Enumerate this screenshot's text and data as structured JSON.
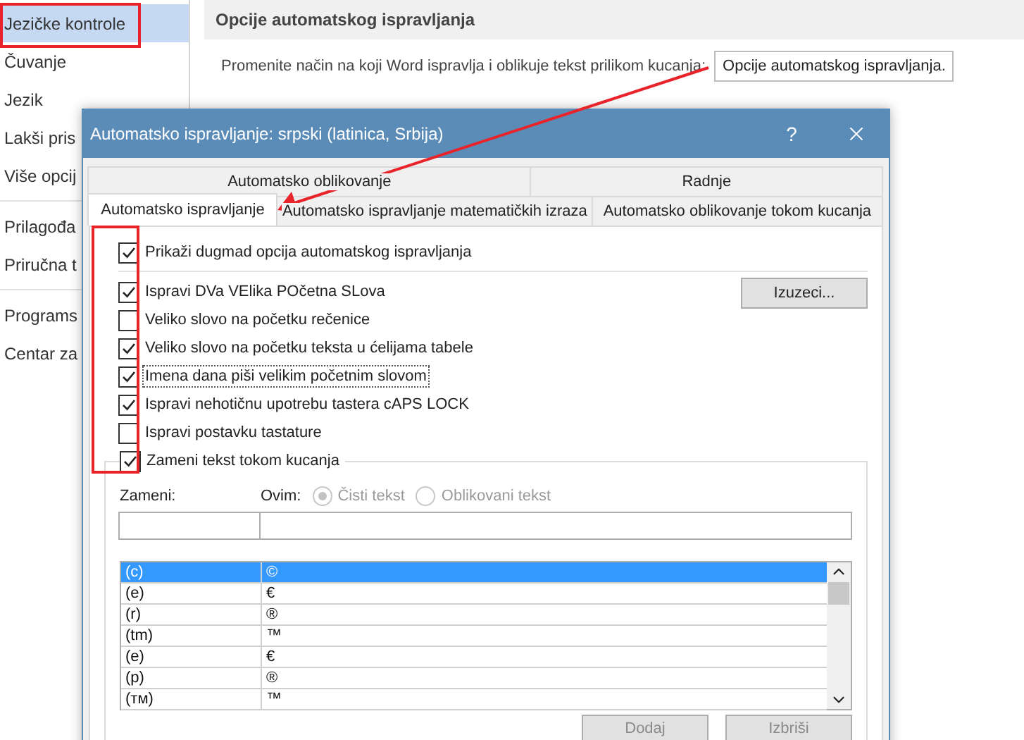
{
  "sidebar": {
    "groups": [
      {
        "items": [
          {
            "label": "Jezičke kontrole",
            "selected": true
          },
          {
            "label": "Čuvanje",
            "selected": false
          },
          {
            "label": "Jezik",
            "selected": false
          },
          {
            "label": "Lakši pris",
            "selected": false
          },
          {
            "label": "Više opcij",
            "selected": false
          }
        ]
      },
      {
        "items": [
          {
            "label": "Prilagođa",
            "selected": false
          },
          {
            "label": "Priručna t",
            "selected": false
          }
        ]
      },
      {
        "items": [
          {
            "label": "Programs",
            "selected": false
          },
          {
            "label": "Centar za",
            "selected": false
          }
        ]
      }
    ]
  },
  "main": {
    "section_title": "Opcije automatskog ispravljanja",
    "description": "Promenite način na koji Word ispravlja i oblikuje tekst prilikom kucanja:",
    "button": "Opcije automatskog ispravljanja."
  },
  "dialog": {
    "title": "Automatsko ispravljanje: srpski (latinica, Srbija)",
    "help": "?",
    "tab_rows": [
      [
        {
          "label": "Automatsko oblikovanje",
          "selected": false
        },
        {
          "label": "Radnje",
          "selected": false
        }
      ],
      [
        {
          "label": "Automatsko ispravljanje",
          "selected": true
        },
        {
          "label": "Automatsko ispravljanje matematičkih izraza",
          "selected": false
        },
        {
          "label": "Automatsko oblikovanje tokom kucanja",
          "selected": false
        }
      ]
    ],
    "show_buttons": {
      "label": "Prikaži dugmad opcija automatskog ispravljanja",
      "checked": true
    },
    "exceptions_button": "Izuzeci...",
    "options": [
      {
        "label": "Ispravi DVa VElika POčetna SLova",
        "checked": true,
        "focused": false
      },
      {
        "label": "Veliko slovo na početku rečenice",
        "checked": false,
        "focused": false
      },
      {
        "label": "Veliko slovo na početku teksta u ćelijama tabele",
        "checked": true,
        "focused": false
      },
      {
        "label": "Imena dana piši velikim početnim slovom",
        "checked": true,
        "focused": true
      },
      {
        "label": "Ispravi nehotičnu upotrebu tastera cAPS LOCK",
        "checked": true,
        "focused": false
      },
      {
        "label": "Ispravi postavku tastature",
        "checked": false,
        "focused": false
      }
    ],
    "replace": {
      "label": "Zameni tekst tokom kucanja",
      "checked": true,
      "replace_label": "Zameni:",
      "with_label": "Ovim:",
      "radios": [
        {
          "label": "Čisti tekst",
          "selected": true,
          "disabled": true
        },
        {
          "label": "Oblikovani tekst",
          "selected": false,
          "disabled": true
        }
      ],
      "entries": [
        {
          "replace": "(c)",
          "with": "©",
          "selected": true
        },
        {
          "replace": "(e)",
          "with": "€",
          "selected": false
        },
        {
          "replace": "(r)",
          "with": "®",
          "selected": false
        },
        {
          "replace": "(tm)",
          "with": "™",
          "selected": false
        },
        {
          "replace": "(е)",
          "with": "€",
          "selected": false
        },
        {
          "replace": "(р)",
          "with": "®",
          "selected": false
        },
        {
          "replace": "(тм)",
          "with": "™",
          "selected": false
        }
      ],
      "buttons": [
        {
          "label": "Dodaj",
          "disabled": true
        },
        {
          "label": "Izbriši",
          "disabled": true
        }
      ]
    }
  }
}
